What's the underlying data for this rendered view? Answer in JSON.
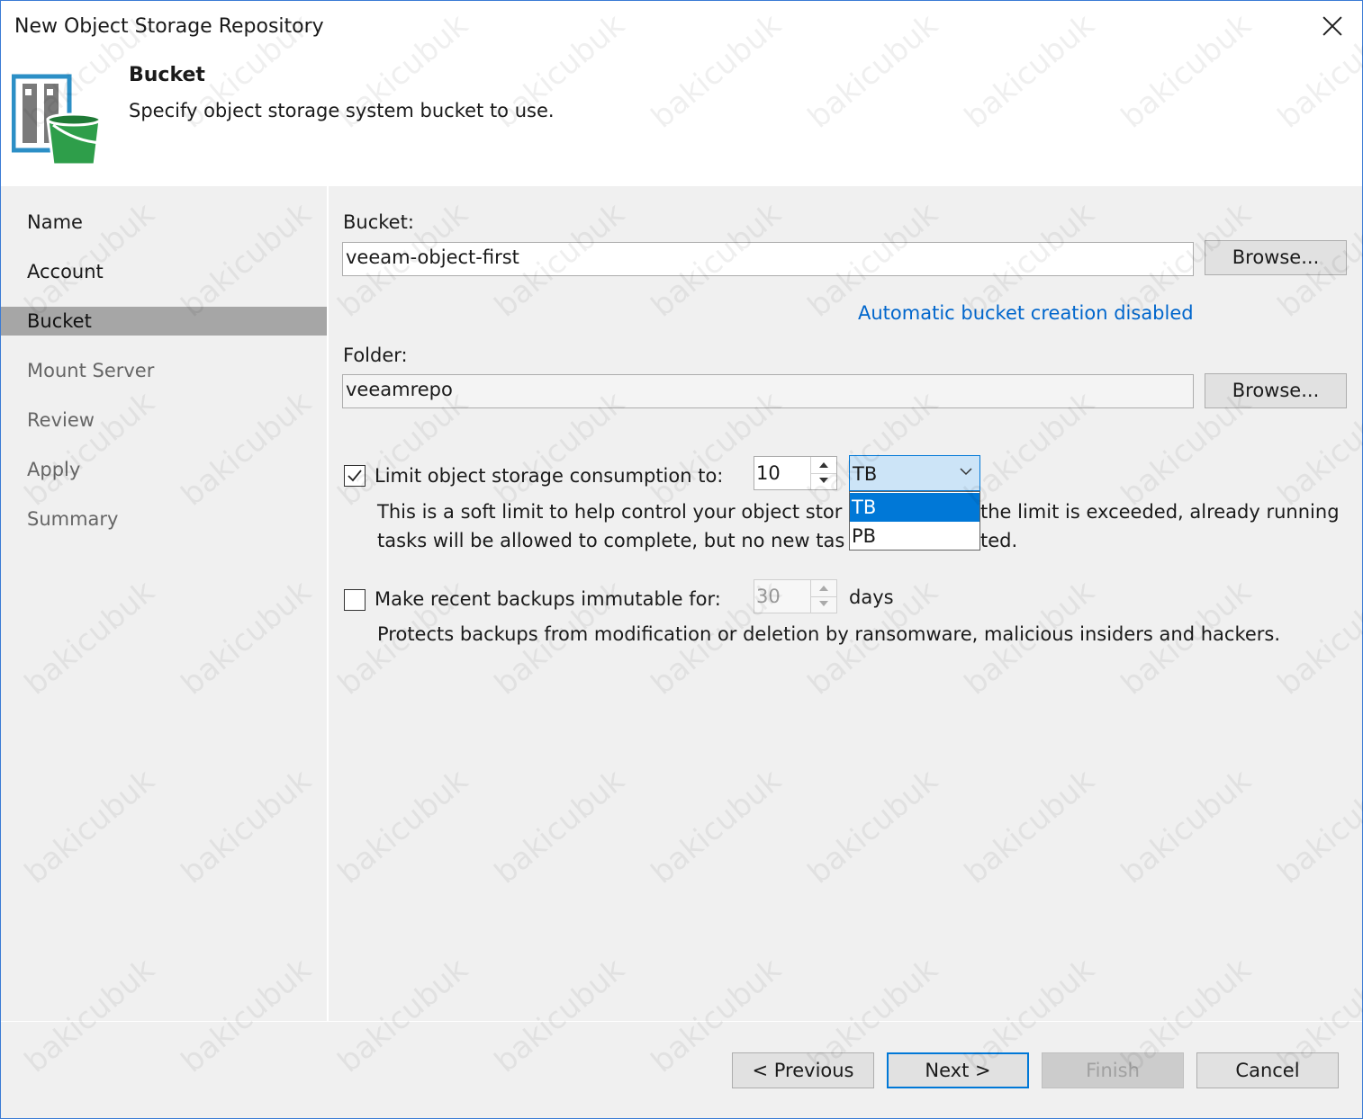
{
  "window": {
    "title": "New Object Storage Repository"
  },
  "header": {
    "step_title": "Bucket",
    "step_description": "Specify object storage system bucket to use."
  },
  "sidebar": {
    "items": [
      {
        "label": "Name",
        "state": "done"
      },
      {
        "label": "Account",
        "state": "done"
      },
      {
        "label": "Bucket",
        "state": "active"
      },
      {
        "label": "Mount Server",
        "state": "pending"
      },
      {
        "label": "Review",
        "state": "pending"
      },
      {
        "label": "Apply",
        "state": "pending"
      },
      {
        "label": "Summary",
        "state": "pending"
      }
    ]
  },
  "form": {
    "bucket_label": "Bucket:",
    "bucket_value": "veeam-object-first",
    "browse_label": "Browse...",
    "auto_bucket_link": "Automatic bucket creation disabled",
    "folder_label": "Folder:",
    "folder_value": "veeamrepo",
    "limit": {
      "checked": true,
      "label": "Limit object storage consumption to:",
      "value": "10",
      "unit_selected": "TB",
      "unit_options": [
        "TB",
        "PB"
      ],
      "desc_line1_left": "This is a soft limit to help control your object stor",
      "desc_line1_right": "the limit is exceeded, already running",
      "desc_line2_left": "tasks will be allowed to complete, but no new tas",
      "desc_line2_right": "ted."
    },
    "immutable": {
      "checked": false,
      "label": "Make recent backups immutable for:",
      "value": "30",
      "unit": "days",
      "description": "Protects backups from modification or deletion by ransomware, malicious insiders and hackers."
    }
  },
  "footer": {
    "previous_label": "< Previous",
    "next_label": "Next >",
    "finish_label": "Finish",
    "cancel_label": "Cancel"
  },
  "watermark": {
    "text": "bakicubuk"
  },
  "colors": {
    "accent": "#0078d7",
    "link": "#0066cc",
    "active_step_bg": "#a6a6a6",
    "panel_bg": "#f0f0f0",
    "icon_green": "#2e9e4a"
  },
  "icons": [
    "close-icon",
    "repository-bucket-icon",
    "checkmark-icon",
    "chevron-down-icon",
    "spin-up-icon",
    "spin-down-icon"
  ]
}
